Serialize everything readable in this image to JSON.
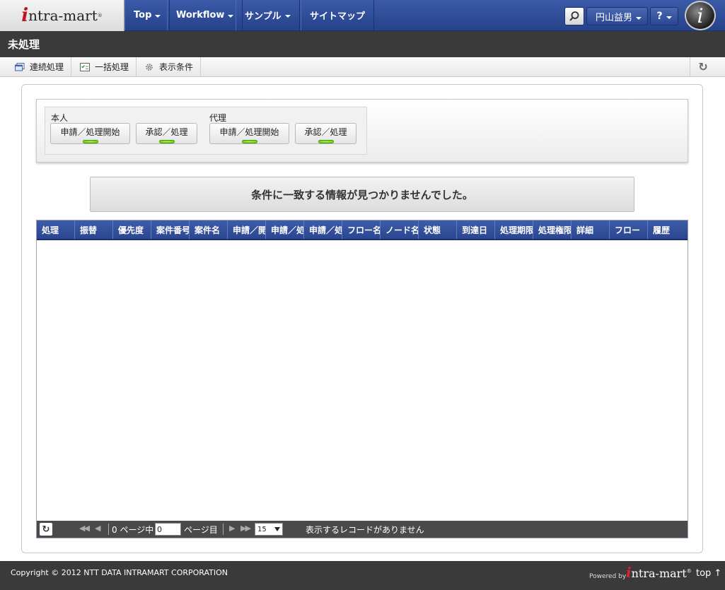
{
  "header": {
    "logo_initial": "i",
    "logo_rest": "ntra-mart",
    "logo_mark": "®",
    "nav": [
      {
        "label": "Top",
        "dropdown": true
      },
      {
        "label": "Workflow",
        "dropdown": true
      },
      {
        "label": "サンプル",
        "dropdown": true
      },
      {
        "label": "サイトマップ",
        "dropdown": false
      }
    ],
    "user_name": "円山益男",
    "help_label": "?",
    "badge_letter": "i"
  },
  "page_title": "未処理",
  "toolbar": {
    "items": [
      {
        "label": "連続処理",
        "icon": "window-icon"
      },
      {
        "label": "一括処理",
        "icon": "checklist-icon"
      },
      {
        "label": "表示条件",
        "icon": "gear-icon"
      }
    ],
    "refresh_icon": "refresh-icon"
  },
  "filters": {
    "self_label": "本人",
    "proxy_label": "代理",
    "apply_start_label": "申請／処理開始",
    "approve_label": "承認／処理"
  },
  "message": "条件に一致する情報が見つかりませんでした。",
  "grid": {
    "columns": [
      "処理",
      "振替",
      "優先度",
      "案件番号",
      "案件名",
      "申請／開",
      "申請／処",
      "申請／処",
      "フロー名",
      "ノード名",
      "状態",
      "到達日",
      "処理期限",
      "処理権限",
      "詳細",
      "フロー",
      "履歴"
    ],
    "rows": []
  },
  "pager": {
    "prefix": "0 ページ中",
    "page_value": "0",
    "suffix": "ページ目",
    "page_size": "15",
    "status": "表示するレコードがありません"
  },
  "footer": {
    "copyright": "Copyright © 2012 NTT DATA INTRAMART CORPORATION",
    "powered_by": "Powered by",
    "logo_initial": "i",
    "logo_rest": "ntra-mart",
    "logo_mark": "®",
    "top_link": "top ↑"
  }
}
